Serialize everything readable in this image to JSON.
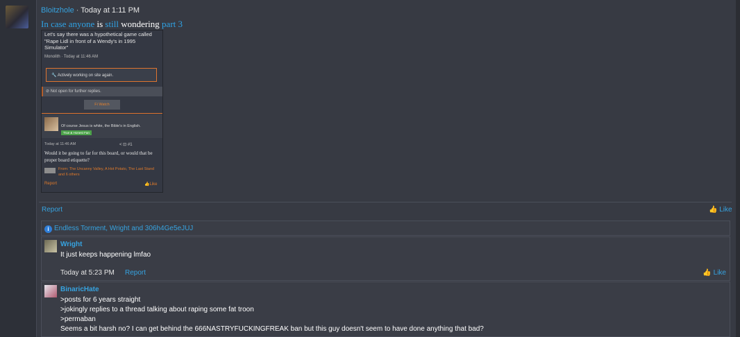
{
  "post": {
    "author": "Bloitzhole",
    "timestamp": "Today at 1:11 PM",
    "message_parts": [
      "In case anyone",
      " is ",
      "still",
      " wondering ",
      "part 3"
    ],
    "report_label": "Report",
    "like_label": "Like"
  },
  "embed": {
    "thread_title": "Let's say there was a hypothetical game called \"Rape Lidl in front of a Wendy's in 1995 Simulator\"",
    "thread_meta": "Monolith · Today at 11:46 AM",
    "notice_box": "Actively working on site again.",
    "closed_notice": "Not open for further replies.",
    "watch_buttons": "Fi   Watch",
    "post_author": "",
    "post_title": "Of course Jesus is white, the Bible's in English.",
    "post_tag": "True & Honest Fan",
    "post_time": "Today at 11:46 AM",
    "post_icons": "<  ⊡  #1",
    "post_text": "Would it be going to far for this board, or would that be proper board etiquette?",
    "reactions": "From: The Uncanny Valley, A Hot Potato, The Last Stand and 6 others",
    "report_label": "Report",
    "like_label": "Like"
  },
  "likers": {
    "text": "Endless Torment, Wright and 306h4Ge5eJUJ"
  },
  "comments": [
    {
      "author": "Wright",
      "lines": [
        "It just keeps happening lmfao"
      ],
      "time": "Today at 5:23 PM",
      "report_label": "Report",
      "like_label": "Like"
    },
    {
      "author": "BinaricHate",
      "lines": [
        ">posts for 6 years straight",
        ">jokingly replies to a thread talking about raping some fat troon",
        ">permaban",
        "Seems a bit harsh no? I can get behind the 666NASTRYFUCKINGFREAK ban but this guy doesn't seem to have done anything that bad?"
      ]
    }
  ],
  "colors": {
    "link": "#36a3e0",
    "accent_orange": "#e0752f",
    "background": "#2d3038"
  }
}
